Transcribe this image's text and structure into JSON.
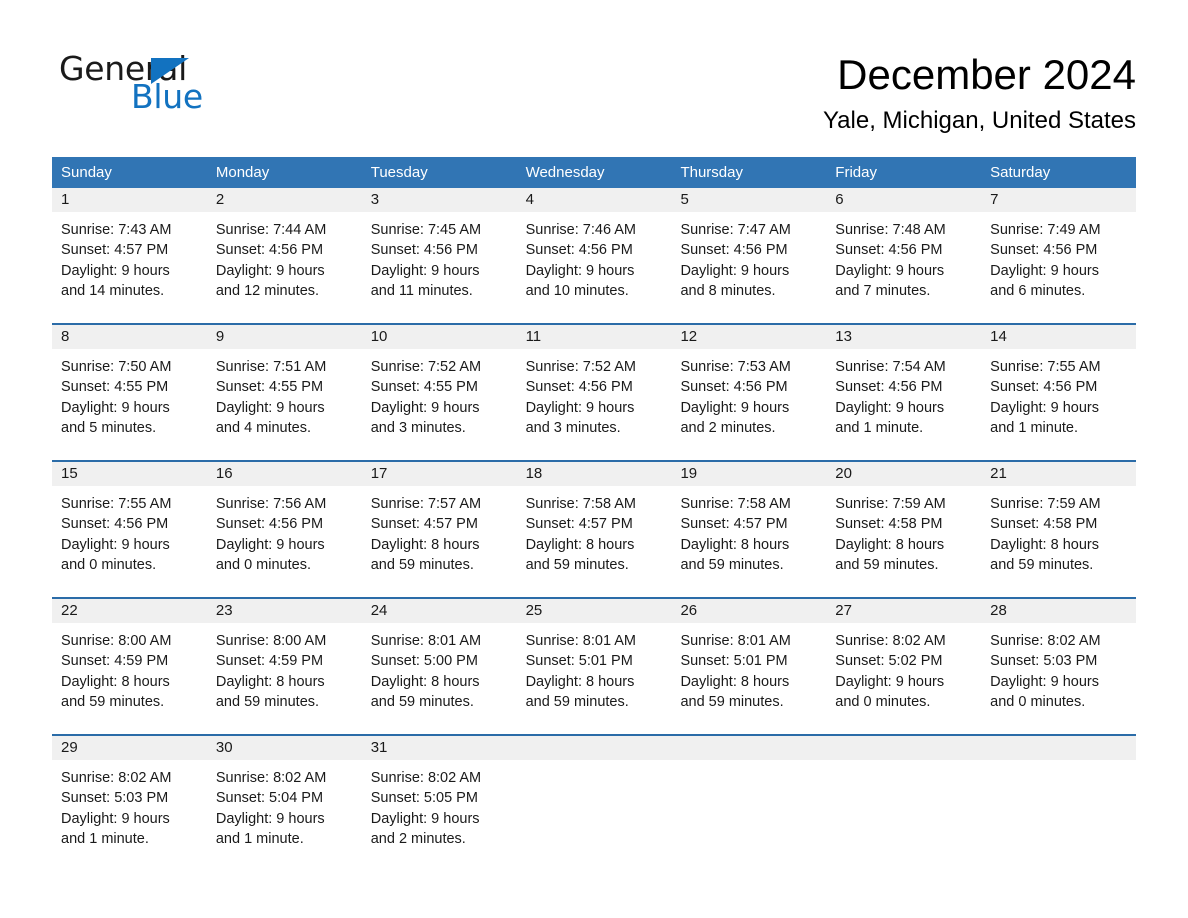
{
  "brand": {
    "name_part1": "General",
    "name_part2": "Blue",
    "flag_icon": "triangle-flag-icon",
    "accent_color": "#1272c0"
  },
  "header": {
    "month_title": "December 2024",
    "location": "Yale, Michigan, United States"
  },
  "calendar": {
    "header_bg": "#3175b4",
    "row_divider_color": "#2b6ca8",
    "day_band_bg": "#f0f0f0",
    "weekdays": [
      "Sunday",
      "Monday",
      "Tuesday",
      "Wednesday",
      "Thursday",
      "Friday",
      "Saturday"
    ],
    "weeks": [
      [
        {
          "day": "1",
          "sunrise": "Sunrise: 7:43 AM",
          "sunset": "Sunset: 4:57 PM",
          "daylight_line1": "Daylight: 9 hours",
          "daylight_line2": "and 14 minutes."
        },
        {
          "day": "2",
          "sunrise": "Sunrise: 7:44 AM",
          "sunset": "Sunset: 4:56 PM",
          "daylight_line1": "Daylight: 9 hours",
          "daylight_line2": "and 12 minutes."
        },
        {
          "day": "3",
          "sunrise": "Sunrise: 7:45 AM",
          "sunset": "Sunset: 4:56 PM",
          "daylight_line1": "Daylight: 9 hours",
          "daylight_line2": "and 11 minutes."
        },
        {
          "day": "4",
          "sunrise": "Sunrise: 7:46 AM",
          "sunset": "Sunset: 4:56 PM",
          "daylight_line1": "Daylight: 9 hours",
          "daylight_line2": "and 10 minutes."
        },
        {
          "day": "5",
          "sunrise": "Sunrise: 7:47 AM",
          "sunset": "Sunset: 4:56 PM",
          "daylight_line1": "Daylight: 9 hours",
          "daylight_line2": "and 8 minutes."
        },
        {
          "day": "6",
          "sunrise": "Sunrise: 7:48 AM",
          "sunset": "Sunset: 4:56 PM",
          "daylight_line1": "Daylight: 9 hours",
          "daylight_line2": "and 7 minutes."
        },
        {
          "day": "7",
          "sunrise": "Sunrise: 7:49 AM",
          "sunset": "Sunset: 4:56 PM",
          "daylight_line1": "Daylight: 9 hours",
          "daylight_line2": "and 6 minutes."
        }
      ],
      [
        {
          "day": "8",
          "sunrise": "Sunrise: 7:50 AM",
          "sunset": "Sunset: 4:55 PM",
          "daylight_line1": "Daylight: 9 hours",
          "daylight_line2": "and 5 minutes."
        },
        {
          "day": "9",
          "sunrise": "Sunrise: 7:51 AM",
          "sunset": "Sunset: 4:55 PM",
          "daylight_line1": "Daylight: 9 hours",
          "daylight_line2": "and 4 minutes."
        },
        {
          "day": "10",
          "sunrise": "Sunrise: 7:52 AM",
          "sunset": "Sunset: 4:55 PM",
          "daylight_line1": "Daylight: 9 hours",
          "daylight_line2": "and 3 minutes."
        },
        {
          "day": "11",
          "sunrise": "Sunrise: 7:52 AM",
          "sunset": "Sunset: 4:56 PM",
          "daylight_line1": "Daylight: 9 hours",
          "daylight_line2": "and 3 minutes."
        },
        {
          "day": "12",
          "sunrise": "Sunrise: 7:53 AM",
          "sunset": "Sunset: 4:56 PM",
          "daylight_line1": "Daylight: 9 hours",
          "daylight_line2": "and 2 minutes."
        },
        {
          "day": "13",
          "sunrise": "Sunrise: 7:54 AM",
          "sunset": "Sunset: 4:56 PM",
          "daylight_line1": "Daylight: 9 hours",
          "daylight_line2": "and 1 minute."
        },
        {
          "day": "14",
          "sunrise": "Sunrise: 7:55 AM",
          "sunset": "Sunset: 4:56 PM",
          "daylight_line1": "Daylight: 9 hours",
          "daylight_line2": "and 1 minute."
        }
      ],
      [
        {
          "day": "15",
          "sunrise": "Sunrise: 7:55 AM",
          "sunset": "Sunset: 4:56 PM",
          "daylight_line1": "Daylight: 9 hours",
          "daylight_line2": "and 0 minutes."
        },
        {
          "day": "16",
          "sunrise": "Sunrise: 7:56 AM",
          "sunset": "Sunset: 4:56 PM",
          "daylight_line1": "Daylight: 9 hours",
          "daylight_line2": "and 0 minutes."
        },
        {
          "day": "17",
          "sunrise": "Sunrise: 7:57 AM",
          "sunset": "Sunset: 4:57 PM",
          "daylight_line1": "Daylight: 8 hours",
          "daylight_line2": "and 59 minutes."
        },
        {
          "day": "18",
          "sunrise": "Sunrise: 7:58 AM",
          "sunset": "Sunset: 4:57 PM",
          "daylight_line1": "Daylight: 8 hours",
          "daylight_line2": "and 59 minutes."
        },
        {
          "day": "19",
          "sunrise": "Sunrise: 7:58 AM",
          "sunset": "Sunset: 4:57 PM",
          "daylight_line1": "Daylight: 8 hours",
          "daylight_line2": "and 59 minutes."
        },
        {
          "day": "20",
          "sunrise": "Sunrise: 7:59 AM",
          "sunset": "Sunset: 4:58 PM",
          "daylight_line1": "Daylight: 8 hours",
          "daylight_line2": "and 59 minutes."
        },
        {
          "day": "21",
          "sunrise": "Sunrise: 7:59 AM",
          "sunset": "Sunset: 4:58 PM",
          "daylight_line1": "Daylight: 8 hours",
          "daylight_line2": "and 59 minutes."
        }
      ],
      [
        {
          "day": "22",
          "sunrise": "Sunrise: 8:00 AM",
          "sunset": "Sunset: 4:59 PM",
          "daylight_line1": "Daylight: 8 hours",
          "daylight_line2": "and 59 minutes."
        },
        {
          "day": "23",
          "sunrise": "Sunrise: 8:00 AM",
          "sunset": "Sunset: 4:59 PM",
          "daylight_line1": "Daylight: 8 hours",
          "daylight_line2": "and 59 minutes."
        },
        {
          "day": "24",
          "sunrise": "Sunrise: 8:01 AM",
          "sunset": "Sunset: 5:00 PM",
          "daylight_line1": "Daylight: 8 hours",
          "daylight_line2": "and 59 minutes."
        },
        {
          "day": "25",
          "sunrise": "Sunrise: 8:01 AM",
          "sunset": "Sunset: 5:01 PM",
          "daylight_line1": "Daylight: 8 hours",
          "daylight_line2": "and 59 minutes."
        },
        {
          "day": "26",
          "sunrise": "Sunrise: 8:01 AM",
          "sunset": "Sunset: 5:01 PM",
          "daylight_line1": "Daylight: 8 hours",
          "daylight_line2": "and 59 minutes."
        },
        {
          "day": "27",
          "sunrise": "Sunrise: 8:02 AM",
          "sunset": "Sunset: 5:02 PM",
          "daylight_line1": "Daylight: 9 hours",
          "daylight_line2": "and 0 minutes."
        },
        {
          "day": "28",
          "sunrise": "Sunrise: 8:02 AM",
          "sunset": "Sunset: 5:03 PM",
          "daylight_line1": "Daylight: 9 hours",
          "daylight_line2": "and 0 minutes."
        }
      ],
      [
        {
          "day": "29",
          "sunrise": "Sunrise: 8:02 AM",
          "sunset": "Sunset: 5:03 PM",
          "daylight_line1": "Daylight: 9 hours",
          "daylight_line2": "and 1 minute."
        },
        {
          "day": "30",
          "sunrise": "Sunrise: 8:02 AM",
          "sunset": "Sunset: 5:04 PM",
          "daylight_line1": "Daylight: 9 hours",
          "daylight_line2": "and 1 minute."
        },
        {
          "day": "31",
          "sunrise": "Sunrise: 8:02 AM",
          "sunset": "Sunset: 5:05 PM",
          "daylight_line1": "Daylight: 9 hours",
          "daylight_line2": "and 2 minutes."
        },
        {
          "day": "",
          "sunrise": "",
          "sunset": "",
          "daylight_line1": "",
          "daylight_line2": ""
        },
        {
          "day": "",
          "sunrise": "",
          "sunset": "",
          "daylight_line1": "",
          "daylight_line2": ""
        },
        {
          "day": "",
          "sunrise": "",
          "sunset": "",
          "daylight_line1": "",
          "daylight_line2": ""
        },
        {
          "day": "",
          "sunrise": "",
          "sunset": "",
          "daylight_line1": "",
          "daylight_line2": ""
        }
      ]
    ]
  }
}
